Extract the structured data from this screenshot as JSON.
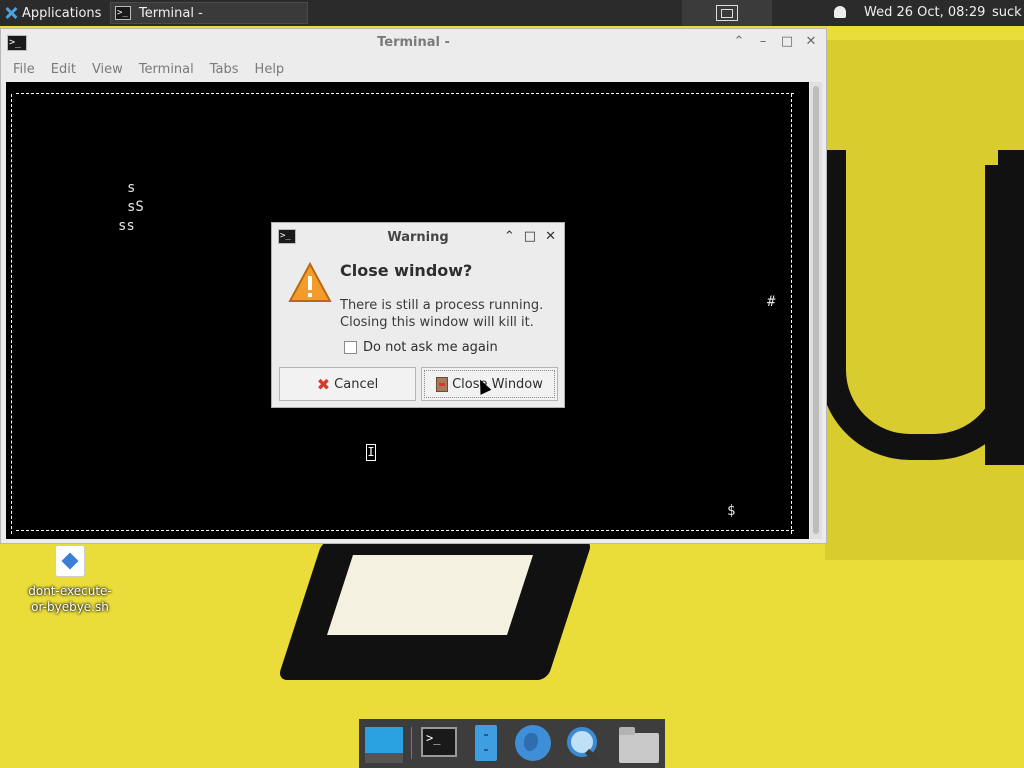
{
  "top_panel": {
    "applications_label": "Applications",
    "task_label": "Terminal -",
    "clock": "Wed 26 Oct, 08:29",
    "user": "suck"
  },
  "terminal": {
    "title": "Terminal -",
    "menu": [
      "File",
      "Edit",
      "View",
      "Terminal",
      "Tabs",
      "Help"
    ],
    "screen_glyphs": {
      "g1": "s",
      "g2": "sS",
      "g3": "ss",
      "hash": "#",
      "dollar": "$",
      "cursor": "I"
    }
  },
  "dialog": {
    "title": "Warning",
    "heading": "Close window?",
    "message_line1": "There is still a process running.",
    "message_line2": "Closing this window will kill it.",
    "checkbox_label": "Do not ask me again",
    "checkbox_checked": false,
    "cancel_label": "Cancel",
    "close_label": "Close Window"
  },
  "desktop_icon": {
    "name_line1": "dont-execute-",
    "name_line2": "or-byebye.sh"
  },
  "dock": {
    "items": [
      "show-desktop",
      "terminal",
      "file-manager",
      "web-browser",
      "app-finder",
      "home-folder"
    ]
  },
  "colors": {
    "panel_bg": "#2b2b2b",
    "wallpaper": "#eadd3a",
    "terminal_bg": "#000000",
    "dialog_bg": "#ececec",
    "accent_blue": "#2aa2e2"
  }
}
